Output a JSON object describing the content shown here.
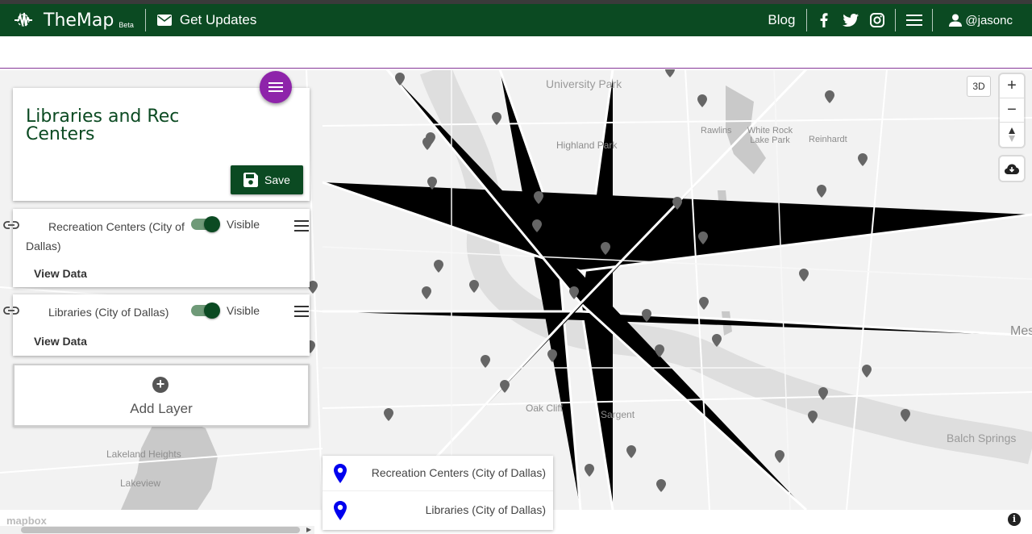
{
  "navbar": {
    "brand_title": "TheMap",
    "brand_badge": "Beta",
    "updates_label": "Get Updates",
    "blog_label": "Blog",
    "username": "@jasonc"
  },
  "colors": {
    "navbar_bg": "#0b4a22",
    "accent_purple": "#8e24aa",
    "legend_pin": "#0000ee",
    "map_pin": "#666666"
  },
  "map_title": "Libraries and Rec Centers",
  "save_label": "Save",
  "layers": [
    {
      "name": "Recreation Centers (City of Dallas)",
      "visible_label": "Visible",
      "visible": true,
      "view_data_label": "View Data"
    },
    {
      "name": "Libraries (City of Dallas)",
      "visible_label": "Visible",
      "visible": true,
      "view_data_label": "View Data"
    }
  ],
  "add_layer_label": "Add Layer",
  "map_controls": {
    "mode_3d": "3D",
    "zoom_in": "+",
    "zoom_out": "−"
  },
  "place_labels": [
    "University Park",
    "Highland Park",
    "Rawlins",
    "White Rock Lake Park",
    "Reinhardt",
    "Oak Cliff",
    "Sargent",
    "Lakeland Heights",
    "Lakeview",
    "Balch Springs",
    "Mes"
  ],
  "legend": [
    {
      "name": "Recreation Centers (City of Dallas)"
    },
    {
      "name": "Libraries (City of Dallas)"
    }
  ],
  "attribution": "mapbox",
  "icons": {
    "logo": "themap-logo-icon",
    "mail": "mail-icon",
    "facebook": "facebook-icon",
    "twitter": "twitter-icon",
    "instagram": "instagram-icon",
    "menu": "menu-icon",
    "user": "user-icon",
    "link": "link-icon",
    "save": "save-icon",
    "compass": "compass-icon",
    "cloud": "cloud-download-icon",
    "info": "info-icon"
  }
}
